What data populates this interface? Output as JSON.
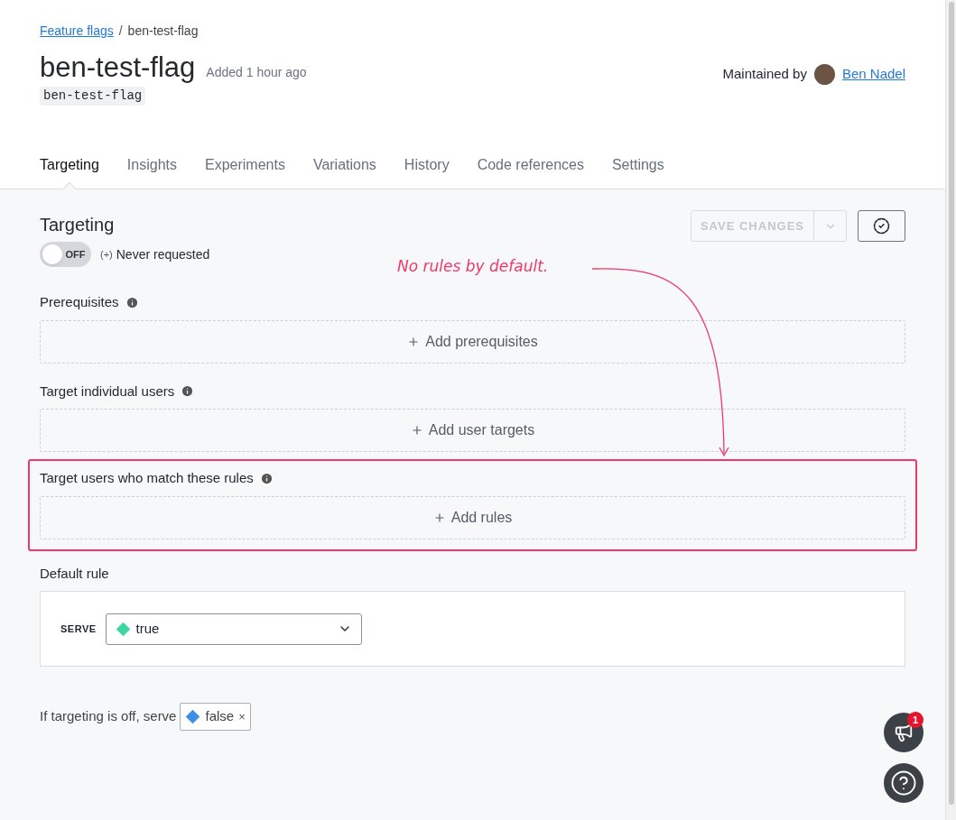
{
  "breadcrumb": {
    "link": "Feature flags",
    "separator": "/",
    "current": "ben-test-flag"
  },
  "flag": {
    "name": "ben-test-flag",
    "added": "Added 1 hour ago",
    "key": "ben-test-flag"
  },
  "maintainer": {
    "label": "Maintained by",
    "name": "Ben Nadel"
  },
  "tabs": [
    {
      "label": "Targeting",
      "selected": true
    },
    {
      "label": "Insights",
      "selected": false
    },
    {
      "label": "Experiments",
      "selected": false
    },
    {
      "label": "Variations",
      "selected": false
    },
    {
      "label": "History",
      "selected": false
    },
    {
      "label": "Code references",
      "selected": false
    },
    {
      "label": "Settings",
      "selected": false
    }
  ],
  "targeting": {
    "title": "Targeting",
    "toggle": {
      "on": false,
      "label": "OFF"
    },
    "status_prefix": "(+)",
    "status": "Never requested"
  },
  "save_button": {
    "label": "SAVE CHANGES",
    "disabled": true
  },
  "sections": [
    {
      "title": "Prerequisites",
      "action": "Add prerequisites",
      "highlighted": false
    },
    {
      "title": "Target individual users",
      "action": "Add user targets",
      "highlighted": false
    },
    {
      "title": "Target users who match these rules",
      "action": "Add rules",
      "highlighted": true
    }
  ],
  "annotation": {
    "text": "No rules by default."
  },
  "default_rule": {
    "title": "Default rule",
    "serve_label": "SERVE",
    "variation": {
      "label": "true",
      "color": "#3dd6a3"
    }
  },
  "off_variation": {
    "prefix": "If targeting is off, serve",
    "variation": {
      "label": "false",
      "color": "#3d8ee8"
    },
    "remove": "×"
  },
  "notifications": {
    "count": "1"
  }
}
